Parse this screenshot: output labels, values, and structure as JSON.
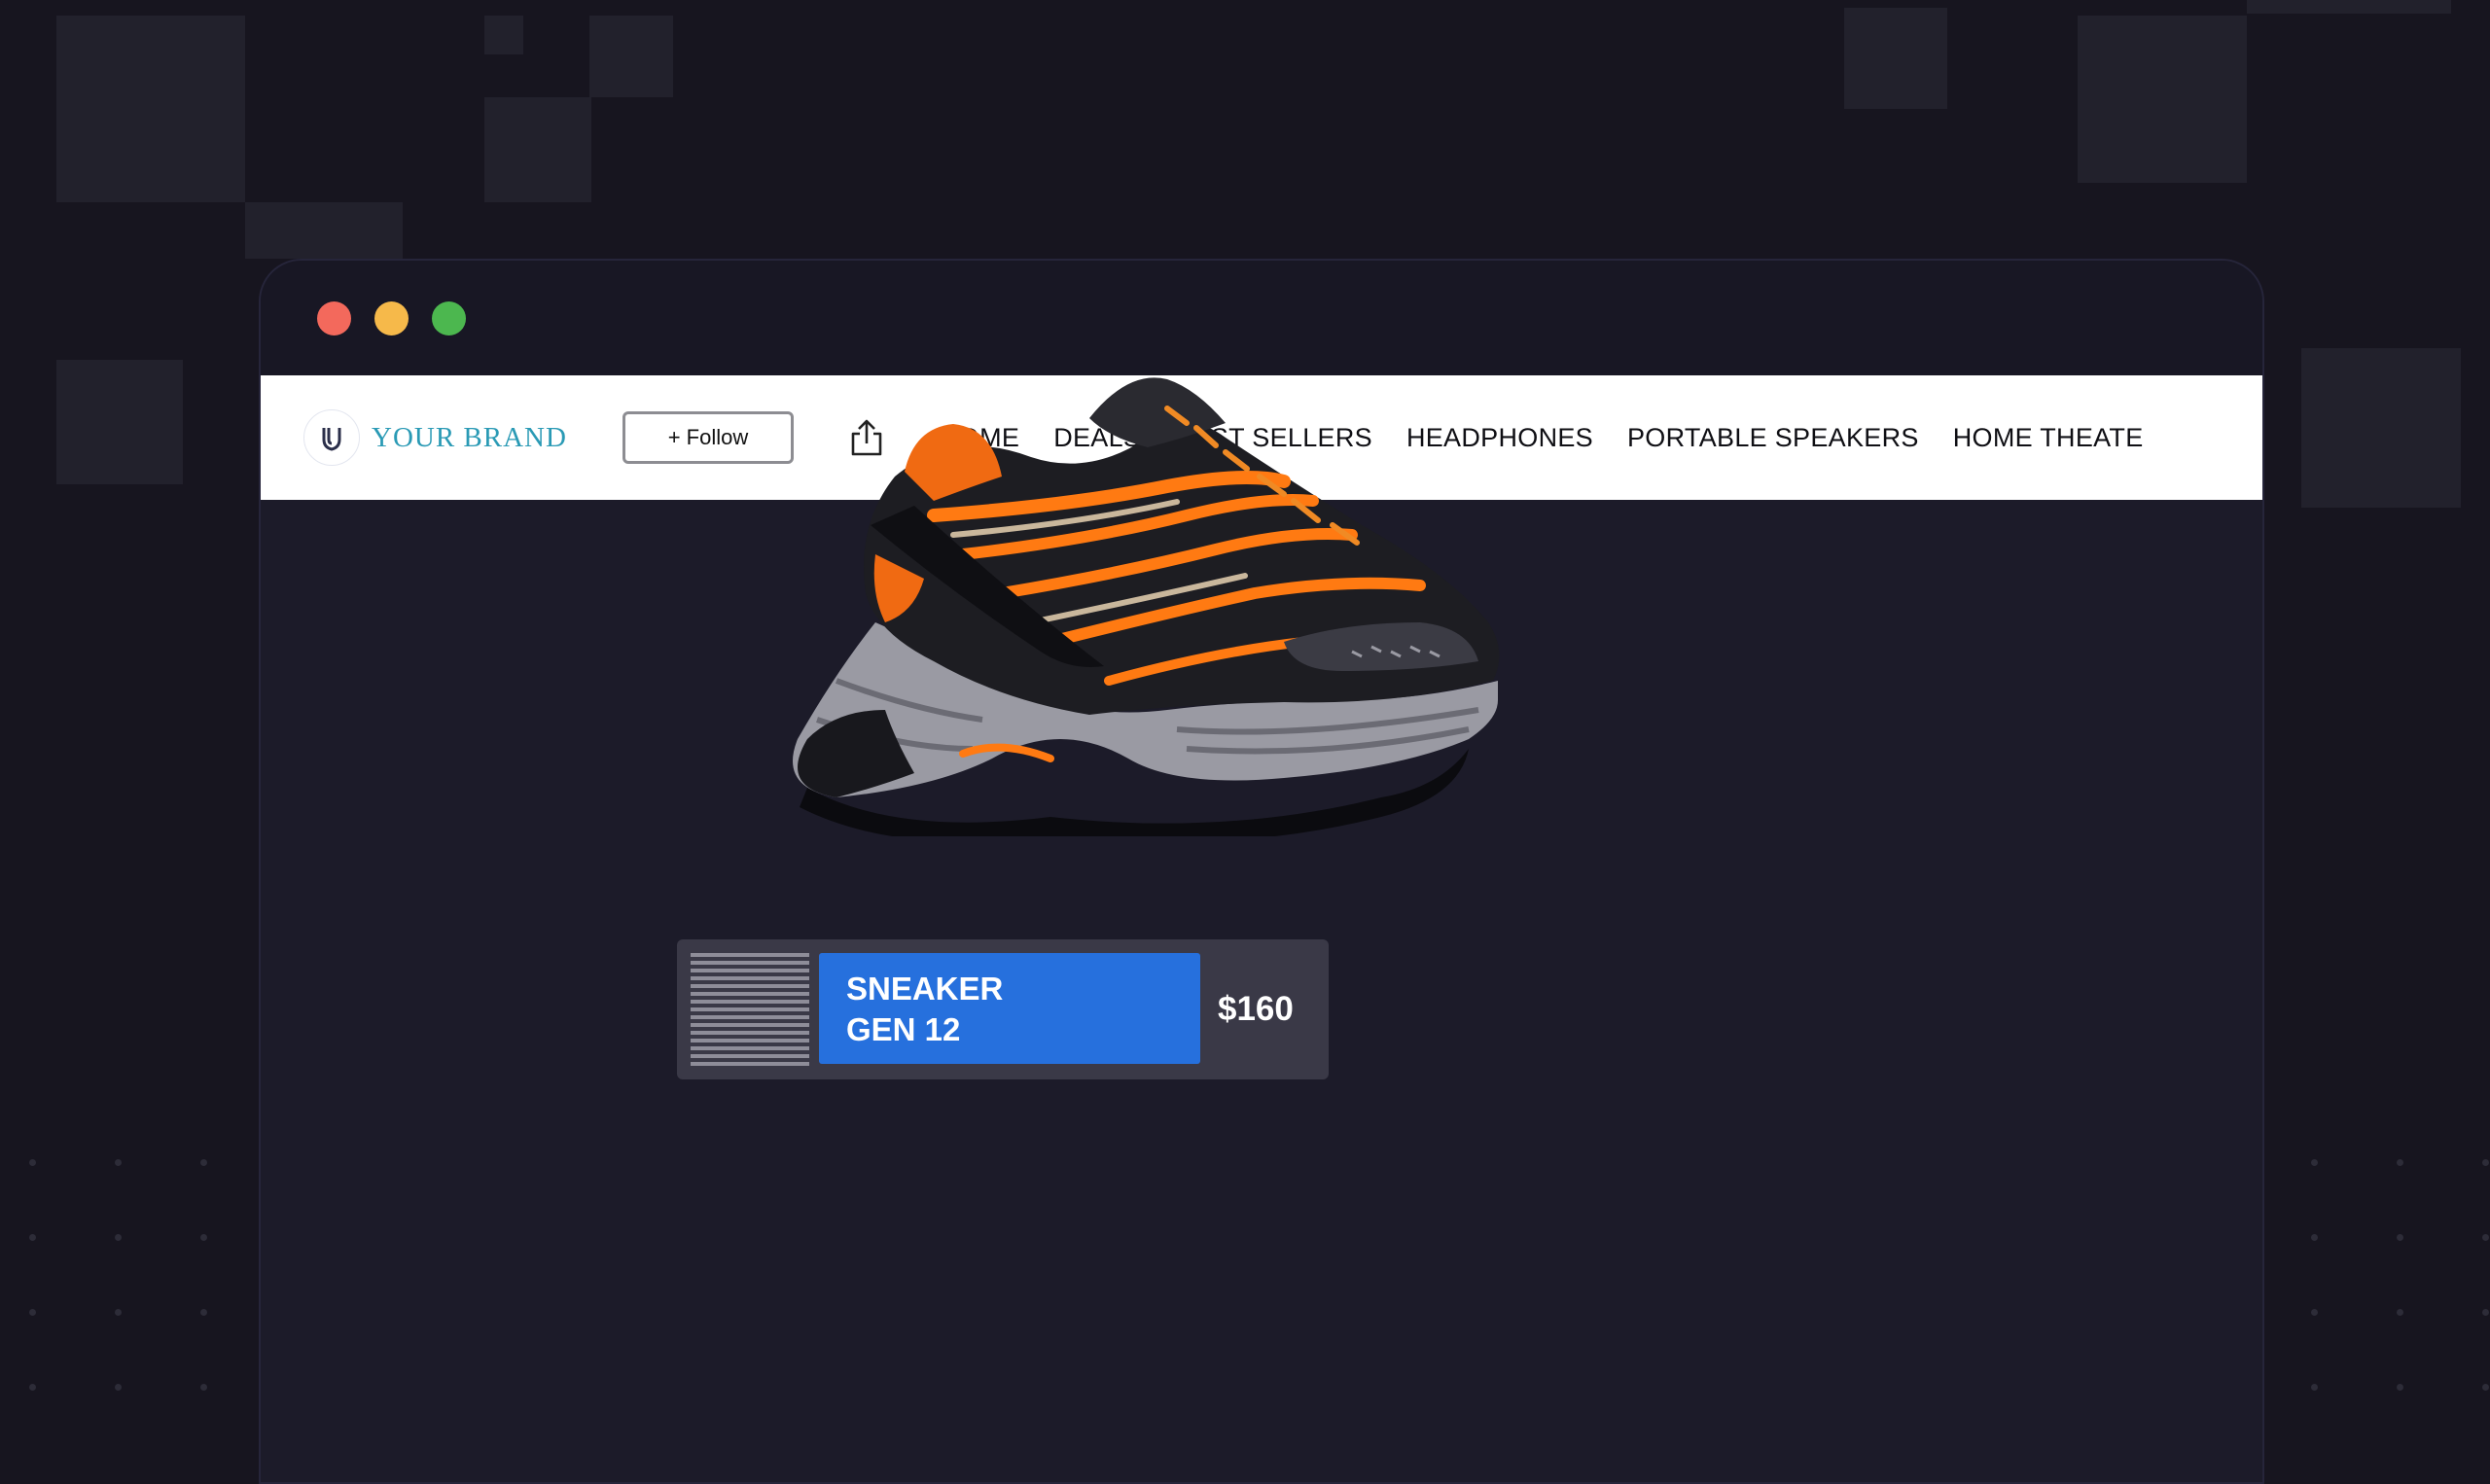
{
  "colors": {
    "background": "#17151f",
    "window": "#1c1b29",
    "accent_blue": "#2670dd",
    "brand_teal": "#2a9ab5",
    "shoe_orange": "#ff7a12",
    "close": "#f3695c",
    "minimize": "#f6b94a",
    "maximize": "#4cb74f"
  },
  "window": {
    "controls": [
      "close",
      "minimize",
      "maximize"
    ]
  },
  "navbar": {
    "brand_name": "YOUR BRAND",
    "brand_icon": "shield-logo-icon",
    "follow_label": "+ Follow",
    "share_icon": "share-icon",
    "links": [
      "HOME",
      "DEALS",
      "BEST SELLERS",
      "HEADPHONES",
      "PORTABLE SPEAKERS",
      "HOME THEATE"
    ],
    "active_link": "HOME"
  },
  "product": {
    "image": "sneaker-image",
    "name_line1": "SNEAKER",
    "name_line2": "GEN 12",
    "price": "$160"
  }
}
